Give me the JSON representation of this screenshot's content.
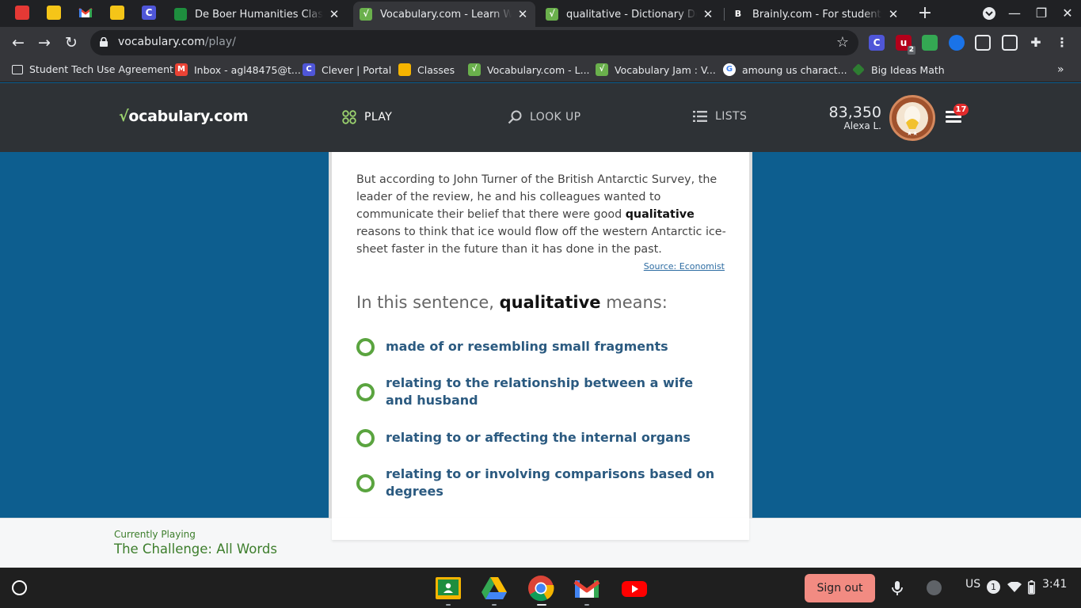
{
  "browser": {
    "tabs": [
      {
        "title": "De Boer Humanities Class Ser",
        "active": false
      },
      {
        "title": "Vocabulary.com - Learn Words",
        "active": true
      },
      {
        "title": "qualitative - Dictionary Definiti",
        "active": false
      },
      {
        "title": "Brainly.com - For students. By",
        "active": false
      }
    ],
    "url_host": "vocabulary.com",
    "url_path": "/play/",
    "extension_badge": "2",
    "bookmarks": [
      "Student Tech Use Agreement",
      "Inbox - agl48475@t...",
      "Clever | Portal",
      "Classes",
      "Vocabulary.com - L...",
      "Vocabulary Jam : V...",
      "amoung us charact...",
      "Big Ideas Math"
    ],
    "bookmarks_more": "»"
  },
  "site": {
    "logo_check": "√",
    "logo_text": "ocabulary.com",
    "nav": {
      "play": "PLAY",
      "lookup": "LOOK UP",
      "lists": "LISTS"
    },
    "points": "83,350",
    "user": "Alexa L.",
    "notification_count": "17",
    "avatar_stars": "★★"
  },
  "question": {
    "sentence_before": "But according to John Turner of the British Antarctic Survey, the leader of the review, he and his colleagues wanted to communicate their belief that there were good ",
    "sentence_word": "qualitative",
    "sentence_after": " reasons to think that ice would flow off the western Antarctic ice-sheet faster in the future than it has done in the past.",
    "source": "Source: Economist",
    "prompt_before": "In this sentence, ",
    "prompt_word": "qualitative",
    "prompt_after": " means:",
    "choices": [
      "made of or resembling small fragments",
      "relating to the relationship between a wife and husband",
      "relating to or affecting the internal organs",
      "relating to or involving comparisons based on degrees"
    ]
  },
  "now_playing": {
    "caption": "Currently Playing",
    "game": "The Challenge: All Words"
  },
  "shelf": {
    "sign_out": "Sign out",
    "keyboard": "US",
    "notifications": "1",
    "time": "3:41"
  },
  "colors": {
    "page_bg": "#0d5e8f",
    "header_bg": "#2e3236",
    "choice_text": "#2b5a80",
    "radio_ring": "#5aa43f",
    "now_playing_text": "#3c7d2b"
  }
}
